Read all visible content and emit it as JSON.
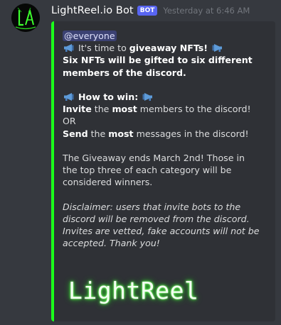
{
  "message": {
    "username": "LightReel.io Bot",
    "badge": "BOT",
    "timestamp": "Yesterday at 6:46 AM"
  },
  "embed": {
    "accent_color": "#1bff1b",
    "mention": "@everyone",
    "line1": {
      "pre": "It's time to ",
      "bold": "giveaway NFTs!"
    },
    "line2": "Six NFTs will be gifted to six different",
    "line3": "members of the discord.",
    "how_heading": "How to win:",
    "invite": {
      "bold1": "Invite",
      "mid": " the ",
      "bold2": "most",
      "post": " members to the discord!"
    },
    "or": "OR",
    "send": {
      "bold1": "Send",
      "mid": " the ",
      "bold2": "most",
      "post": " messages in the discord!"
    },
    "giveaway_lines": [
      "The Giveaway ends March 2nd! Those in",
      "the top three of each category will be",
      "considered winners."
    ],
    "disclaimer_lines": [
      "Disclaimer: users that invite bots to the",
      "discord will be removed from the discord.",
      "Invites are vetted, fake accounts will not be",
      "accepted. Thank you!"
    ],
    "logo_text": "LightReel",
    "icon": "megaphone-icon"
  }
}
